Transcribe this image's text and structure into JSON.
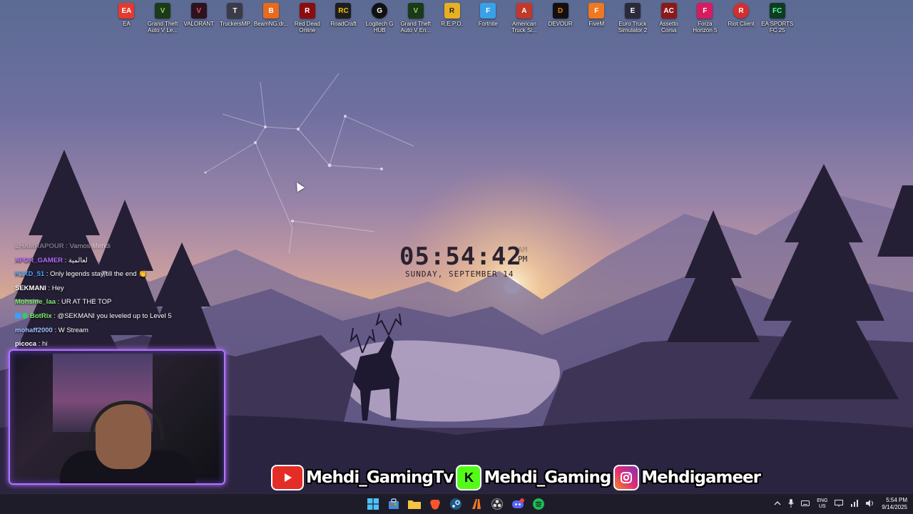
{
  "desktop_icons": [
    {
      "label": "EA",
      "icon": "ea-icon",
      "color": "#e23b2e",
      "glyph": "EA"
    },
    {
      "label": "Grand Theft Auto V Le...",
      "icon": "gta-v-icon",
      "color": "#1a3a1a",
      "glyph": "V"
    },
    {
      "label": "VALORANT",
      "icon": "valorant-icon",
      "color": "#2b1420",
      "glyph": "V"
    },
    {
      "label": "TruckersMP",
      "icon": "truckersmp-icon",
      "color": "#3a3a4a",
      "glyph": "T"
    },
    {
      "label": "BeamNG.dr...",
      "icon": "beamng-icon",
      "color": "#e86a1e",
      "glyph": "B"
    },
    {
      "label": "Red Dead Online",
      "icon": "red-dead-icon",
      "color": "#8b0d0d",
      "glyph": "R"
    },
    {
      "label": "RoadCraft",
      "icon": "roadcraft-icon",
      "color": "#1e1e1e",
      "glyph": "RC"
    },
    {
      "label": "Logitech G HUB",
      "icon": "logitech-icon",
      "color": "#111111",
      "glyph": "G"
    },
    {
      "label": "Grand Theft Auto V En...",
      "icon": "gta-v-enhanced-icon",
      "color": "#1a3a1a",
      "glyph": "V"
    },
    {
      "label": "R.E.P.O.",
      "icon": "repo-icon",
      "color": "#e8b020",
      "glyph": "R"
    },
    {
      "label": "Fortnite",
      "icon": "fortnite-icon",
      "color": "#3aa0e8",
      "glyph": "F"
    },
    {
      "label": "American Truck Si...",
      "icon": "american-truck-icon",
      "color": "#c0392b",
      "glyph": "A"
    },
    {
      "label": "DEVOUR",
      "icon": "devour-icon",
      "color": "#101010",
      "glyph": "D"
    },
    {
      "label": "FiveM",
      "icon": "fivem-icon",
      "color": "#f07820",
      "glyph": "F"
    },
    {
      "label": "Euro Truck Simulator 2",
      "icon": "euro-truck-icon",
      "color": "#2a2a3a",
      "glyph": "E"
    },
    {
      "label": "Assetto Corsa",
      "icon": "assetto-corsa-icon",
      "color": "#8a1a1a",
      "glyph": "AC"
    },
    {
      "label": "Forza Horizon 5",
      "icon": "forza-icon",
      "color": "#d81b60",
      "glyph": "F"
    },
    {
      "label": "Riot Client",
      "icon": "riot-icon",
      "color": "#d32f2f",
      "glyph": "R"
    },
    {
      "label": "EA SPORTS FC 25",
      "icon": "ea-fc-icon",
      "color": "#0d3b24",
      "glyph": "FC"
    }
  ],
  "clock": {
    "time": "05:54:42",
    "am": "AM",
    "pm": "PM",
    "date": "SUNDAY, SEPTEMBER 14"
  },
  "chat": [
    {
      "user": "LHAMRAPOUR",
      "message": "Vamos Mehdi",
      "color": "#b9b9c9"
    },
    {
      "user": "XFOR_GAMER",
      "message": "لعالمية",
      "color": "#b46cff"
    },
    {
      "user": "K1XD_51",
      "message": "Only legends stay till the end 👏",
      "color": "#4aa3ff"
    },
    {
      "user": "SEKMANI",
      "message": "Hey",
      "color": "#ffffff"
    },
    {
      "user": "Mohsine_laa",
      "message": "UR AT THE TOP",
      "color": "#7cf06a"
    },
    {
      "user": "BotRix",
      "message": "@SEKMANI you leveled up to Level 5",
      "color": "#7cf06a",
      "badges": true
    },
    {
      "user": "mohaff2000",
      "message": "W Stream",
      "color": "#9ec3ff"
    },
    {
      "user": "picoca",
      "message": "hi",
      "color": "#ffffff"
    }
  ],
  "socials": [
    {
      "platform": "youtube",
      "icon": "youtube-icon",
      "handle": "Mehdi_GamingTv",
      "color": "#e52d27"
    },
    {
      "platform": "kick",
      "icon": "kick-icon",
      "handle": "Mehdi_Gaming",
      "color": "#53fc18"
    },
    {
      "platform": "instagram",
      "icon": "instagram-icon",
      "handle": "Mehdigameer",
      "color": "#c13584"
    }
  ],
  "taskbar": {
    "apps": [
      {
        "name": "start",
        "icon": "windows-start-icon",
        "color": "#4cc2ff"
      },
      {
        "name": "store",
        "icon": "store-icon",
        "color": "#3d8bd8"
      },
      {
        "name": "file-explorer",
        "icon": "folder-icon",
        "color": "#f5c542"
      },
      {
        "name": "brave",
        "icon": "brave-icon",
        "color": "#fb542b"
      },
      {
        "name": "steam",
        "icon": "steam-icon",
        "color": "#1b5b8a"
      },
      {
        "name": "fivem",
        "icon": "fivem-taskbar-icon",
        "color": "#f07820"
      },
      {
        "name": "obs",
        "icon": "obs-icon",
        "color": "#302e31"
      },
      {
        "name": "discord",
        "icon": "discord-icon",
        "color": "#5865f2"
      },
      {
        "name": "spotify",
        "icon": "spotify-icon",
        "color": "#1db954"
      }
    ],
    "tray": {
      "lang_top": "ENG",
      "lang_bottom": "US",
      "time": "5:54 PM",
      "date": "9/14/2025"
    }
  }
}
